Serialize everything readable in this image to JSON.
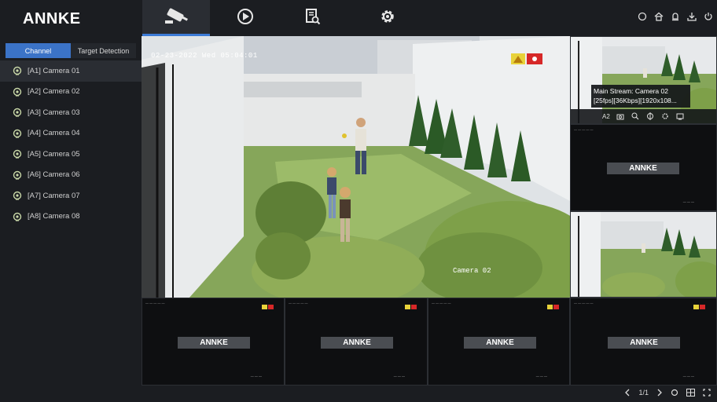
{
  "app": {
    "logo": "ANNKE"
  },
  "nav": {
    "tabs": [
      {
        "id": "live-view",
        "icon": "camera-icon",
        "active": true
      },
      {
        "id": "playback",
        "icon": "playback-icon",
        "active": false
      },
      {
        "id": "search",
        "icon": "file-search-icon",
        "active": false
      },
      {
        "id": "settings",
        "icon": "gear-icon",
        "active": false
      }
    ],
    "right_icons": [
      "refresh-icon",
      "home-icon",
      "alarm-icon",
      "download-icon",
      "power-icon"
    ]
  },
  "panel": {
    "tabs": [
      "Channel",
      "Target Detection"
    ],
    "channels": [
      {
        "label": "[A1] Camera 01"
      },
      {
        "label": "[A2] Camera 02"
      },
      {
        "label": "[A3] Camera 03"
      },
      {
        "label": "[A4] Camera 04"
      },
      {
        "label": "[A5] Camera 05"
      },
      {
        "label": "[A6] Camera 06"
      },
      {
        "label": "[A7] Camera 07"
      },
      {
        "label": "[A8] Camera 08"
      }
    ]
  },
  "main_view": {
    "osd": "02-23-2022 Wed 05:04:01",
    "camera_label": "Camera 02"
  },
  "tooltip": {
    "line1": "Main Stream: Camera 02",
    "line2": "[25fps][36Kbps][1920x108..."
  },
  "toolbar": {
    "channel": "A2",
    "icons": [
      "snapshot-icon",
      "zoom-icon",
      "ptz-icon",
      "settings-icon",
      "stream-icon"
    ]
  },
  "empty_logo": "ANNKE",
  "pager": {
    "page": "1/1"
  },
  "colors": {
    "accent": "#3b73c7",
    "background": "#15171a",
    "panel": "#1b1d21"
  }
}
